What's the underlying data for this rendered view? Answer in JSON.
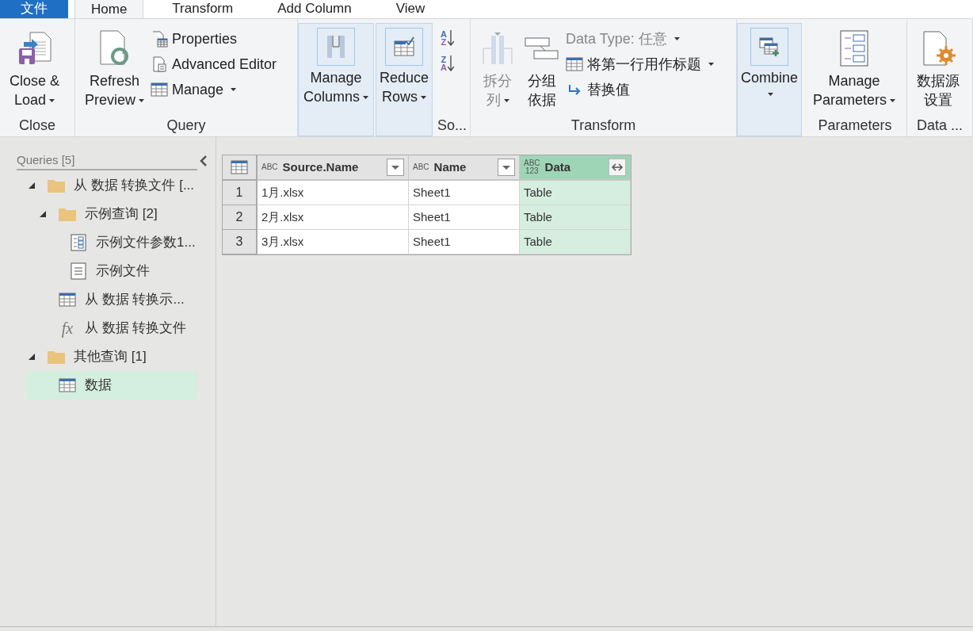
{
  "tabs": [
    {
      "label": "文件",
      "kind": "file",
      "selected": false
    },
    {
      "label": "Home",
      "kind": "tab",
      "selected": true
    },
    {
      "label": "Transform",
      "kind": "tab",
      "selected": false
    },
    {
      "label": "Add Column",
      "kind": "tab",
      "selected": false
    },
    {
      "label": "View",
      "kind": "tab",
      "selected": false
    }
  ],
  "ribbon": [
    {
      "kind": "group",
      "label": "Close",
      "items": [
        {
          "kind": "large",
          "lines": [
            "Close &",
            "Load"
          ],
          "dropdown": true,
          "disabled": false
        }
      ]
    },
    {
      "kind": "group",
      "label": "Query",
      "items": [
        {
          "kind": "large",
          "lines": [
            "Refresh",
            "Preview"
          ],
          "dropdown": true,
          "disabled": false
        },
        {
          "kind": "small",
          "label": "Properties",
          "dropdown": false,
          "disabled": false
        },
        {
          "kind": "small",
          "label": "Advanced Editor",
          "dropdown": false,
          "disabled": false
        },
        {
          "kind": "small",
          "label": "Manage",
          "dropdown": true,
          "disabled": false
        }
      ]
    },
    {
      "kind": "collapsed",
      "lines": [
        "Manage",
        "Columns"
      ],
      "dropdown": true
    },
    {
      "kind": "collapsed",
      "lines": [
        "Reduce",
        "Rows"
      ],
      "dropdown": true
    },
    {
      "kind": "group",
      "label": "So...",
      "items": [
        {
          "kind": "sort",
          "glyphs": [
            "A",
            "Z"
          ]
        },
        {
          "kind": "sort",
          "glyphs": [
            "Z",
            "A"
          ]
        }
      ]
    },
    {
      "kind": "group",
      "label": "Transform",
      "items": [
        {
          "kind": "large",
          "lines": [
            "拆分",
            "列"
          ],
          "dropdown": true,
          "disabled": true
        },
        {
          "kind": "large",
          "lines": [
            "分组",
            "依据"
          ],
          "dropdown": false,
          "disabled": false
        },
        {
          "kind": "small",
          "label": "Data Type: 任意",
          "dropdown": true,
          "disabled": true
        },
        {
          "kind": "small",
          "label": "将第一行用作标题",
          "dropdown": true,
          "disabled": false
        },
        {
          "kind": "small",
          "label": "替换值",
          "dropdown": false,
          "disabled": false
        }
      ]
    },
    {
      "kind": "collapsed",
      "lines": [
        "Combine"
      ],
      "dropdown": true
    },
    {
      "kind": "group",
      "label": "Parameters",
      "items": [
        {
          "kind": "large",
          "lines": [
            "Manage",
            "Parameters"
          ],
          "dropdown": true,
          "disabled": false
        }
      ]
    },
    {
      "kind": "group",
      "label": "Data ...",
      "items": [
        {
          "kind": "large",
          "lines": [
            "数据源",
            "设置"
          ],
          "dropdown": false,
          "disabled": false
        }
      ]
    }
  ],
  "queries": {
    "title": "Queries [5]",
    "tree": [
      {
        "kind": "folder",
        "label": "从 数据 转换文件 [...",
        "expanded": true,
        "selected": false,
        "children": [
          {
            "kind": "folder",
            "label": "示例查询 [2]",
            "expanded": true,
            "selected": false,
            "children": [
              {
                "kind": "parameter",
                "label": "示例文件参数1...",
                "selected": false
              },
              {
                "kind": "document",
                "label": "示例文件",
                "selected": false
              }
            ]
          },
          {
            "kind": "table",
            "label": "从 数据 转换示...",
            "selected": false
          },
          {
            "kind": "function",
            "glyph": "fx",
            "label": "从 数据 转换文件",
            "selected": false
          }
        ]
      },
      {
        "kind": "folder",
        "label": "其他查询 [1]",
        "expanded": true,
        "selected": false,
        "children": [
          {
            "kind": "table",
            "label": "数据",
            "selected": true
          }
        ]
      }
    ]
  },
  "grid": {
    "columns": [
      {
        "type": [
          "ABC"
        ],
        "name": "Source.Name",
        "selected": false,
        "kind": "dropdown"
      },
      {
        "type": [
          "ABC"
        ],
        "name": "Name",
        "selected": false,
        "kind": "dropdown"
      },
      {
        "type": [
          "ABC",
          "123"
        ],
        "name": "Data",
        "selected": true,
        "kind": "expand"
      }
    ],
    "rows": [
      {
        "number": "1",
        "cells": [
          "1月.xlsx",
          "Sheet1",
          "Table"
        ]
      },
      {
        "number": "2",
        "cells": [
          "2月.xlsx",
          "Sheet1",
          "Table"
        ]
      },
      {
        "number": "3",
        "cells": [
          "3月.xlsx",
          "Sheet1",
          "Table"
        ]
      }
    ]
  }
}
